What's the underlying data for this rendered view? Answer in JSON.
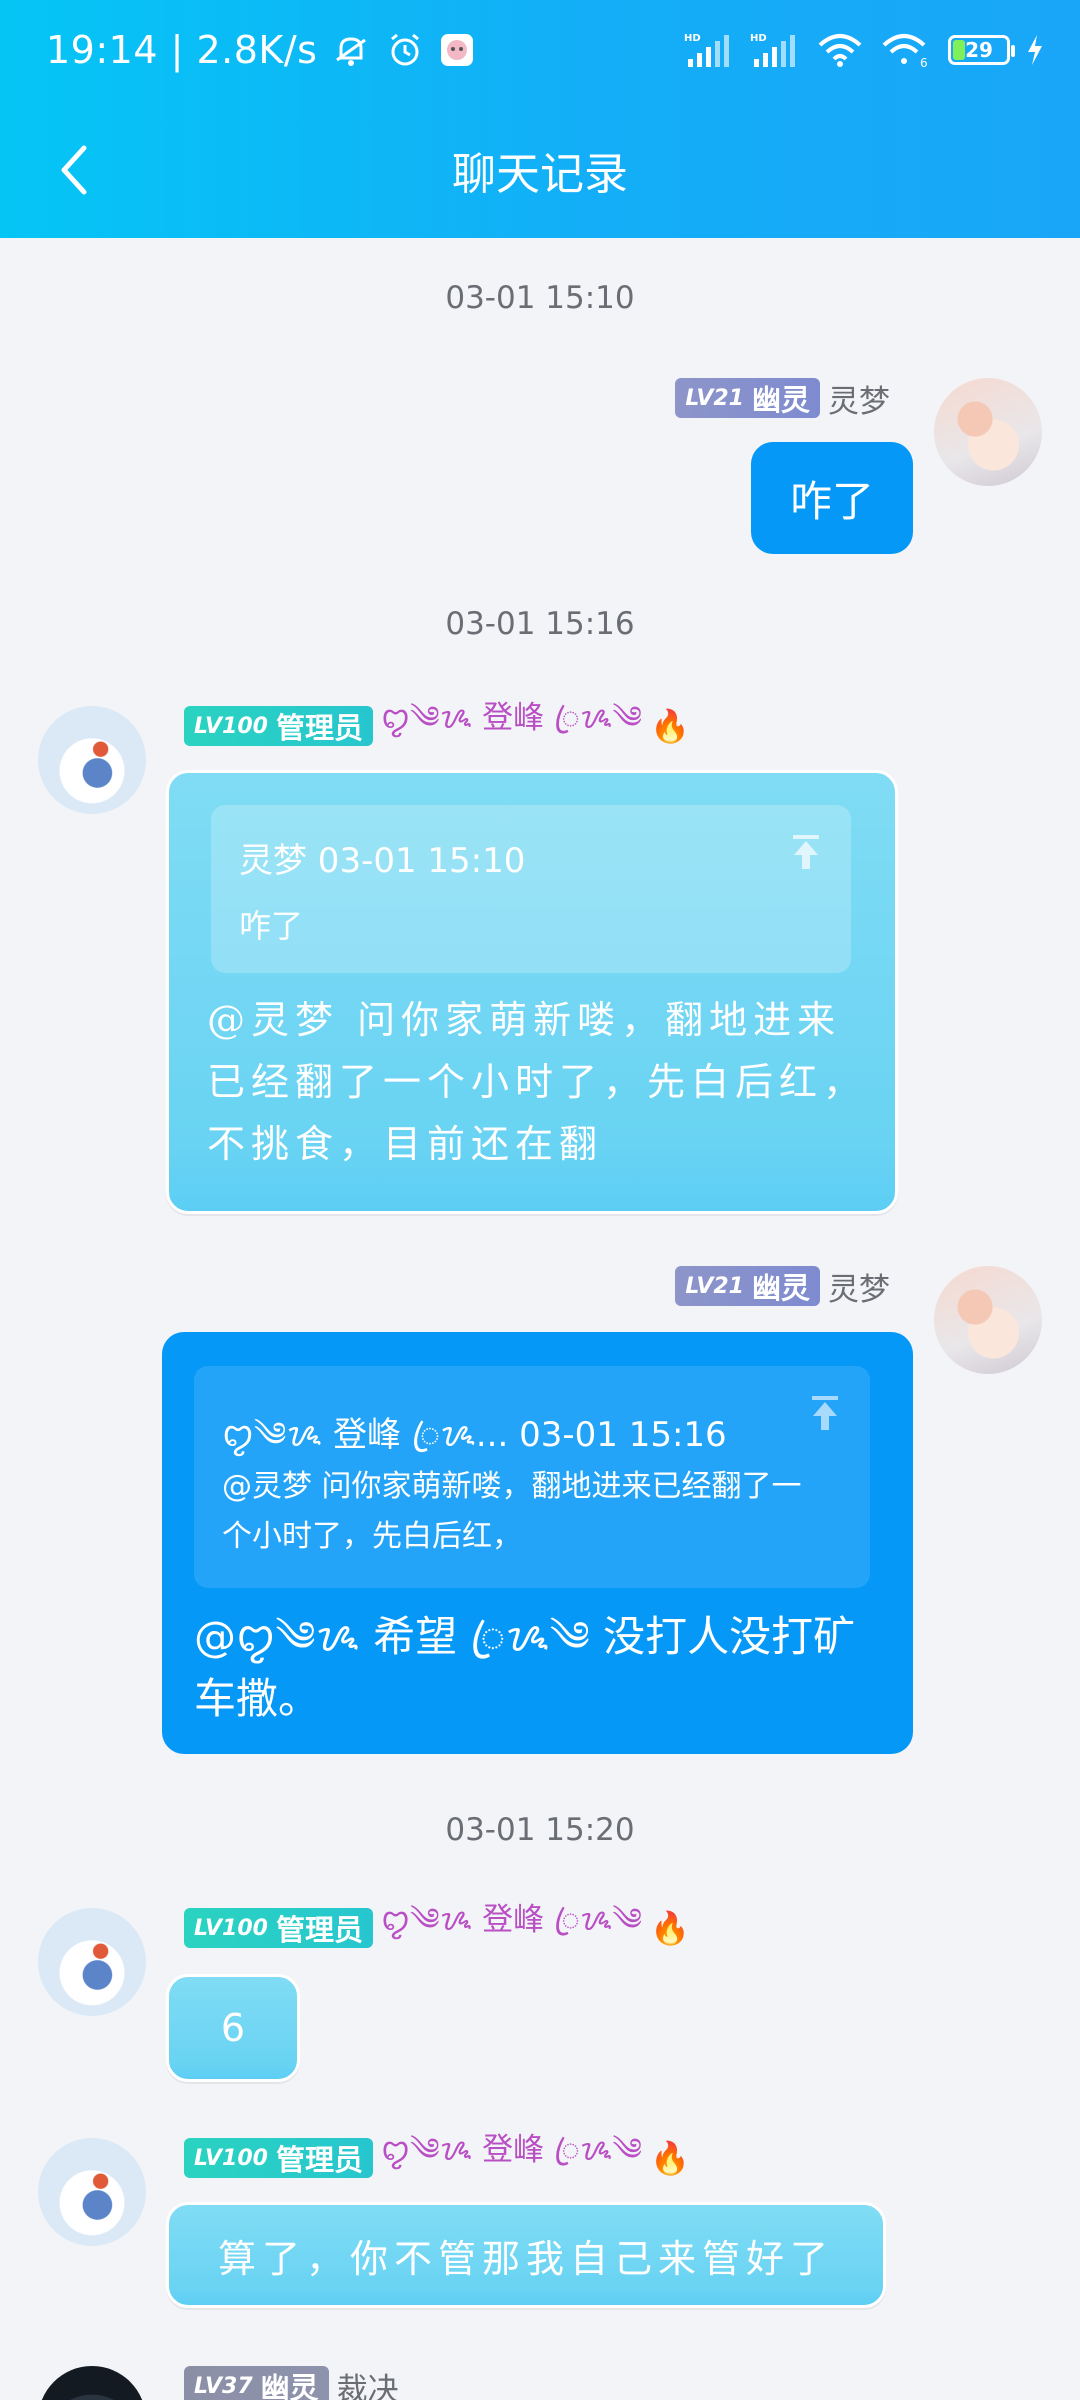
{
  "status_bar": {
    "time_speed": "19:14 | 2.8K/s",
    "battery": "29"
  },
  "header": {
    "title": "聊天记录"
  },
  "messages": [
    {
      "timestamp": "03-01 15:10"
    },
    {
      "sender": "灵梦",
      "level": "LV21",
      "role": "幽灵",
      "text": "咋了"
    },
    {
      "timestamp": "03-01 15:16"
    },
    {
      "sender": "ꦿ༄ᝰ登峰ꦿᝰ☯ꦿ",
      "sender_display": "ꨄ༄ᝰ 登峰 ꦿᝰ༄",
      "level": "LV100",
      "role": "管理员",
      "quote": {
        "author_time": "灵梦 03-01 15:10",
        "text": "咋了"
      },
      "text": "@灵梦 问你家萌新喽，翻地进来已经翻了一个小时了，先白后红，不挑食，目前还在翻"
    },
    {
      "sender": "灵梦",
      "level": "LV21",
      "role": "幽灵",
      "quote": {
        "author_time": "ꨄ༄ᝰ 登峰 ꦿᝰ... 03-01 15:16",
        "text": "@灵梦 问你家萌新喽，翻地进来已经翻了一个小时了，先白后红，"
      },
      "text": "@ꨄ༄ᝰ 希望 ꦿᝰ༄ 没打人没打矿车撒。"
    },
    {
      "timestamp": "03-01 15:20"
    },
    {
      "sender_display": "ꨄ༄ᝰ 登峰 ꦿᝰ༄",
      "level": "LV100",
      "role": "管理员",
      "text": "6"
    },
    {
      "sender_display": "ꨄ༄ᝰ 登峰 ꦿᝰ༄",
      "level": "LV100",
      "role": "管理员",
      "text": "算了，你不管那我自己来管好了"
    },
    {
      "sender": "裁决",
      "level": "LV37",
      "role": "幽灵"
    }
  ],
  "colors": {
    "header_gradient_start": "#05c5f5",
    "header_gradient_end": "#1aa6f8",
    "bubble_blue": "#0598f7",
    "bubble_cyan": "#6fd5f3",
    "badge_admin": "#2ad3c0",
    "badge_ghost": "#8d95c9"
  }
}
